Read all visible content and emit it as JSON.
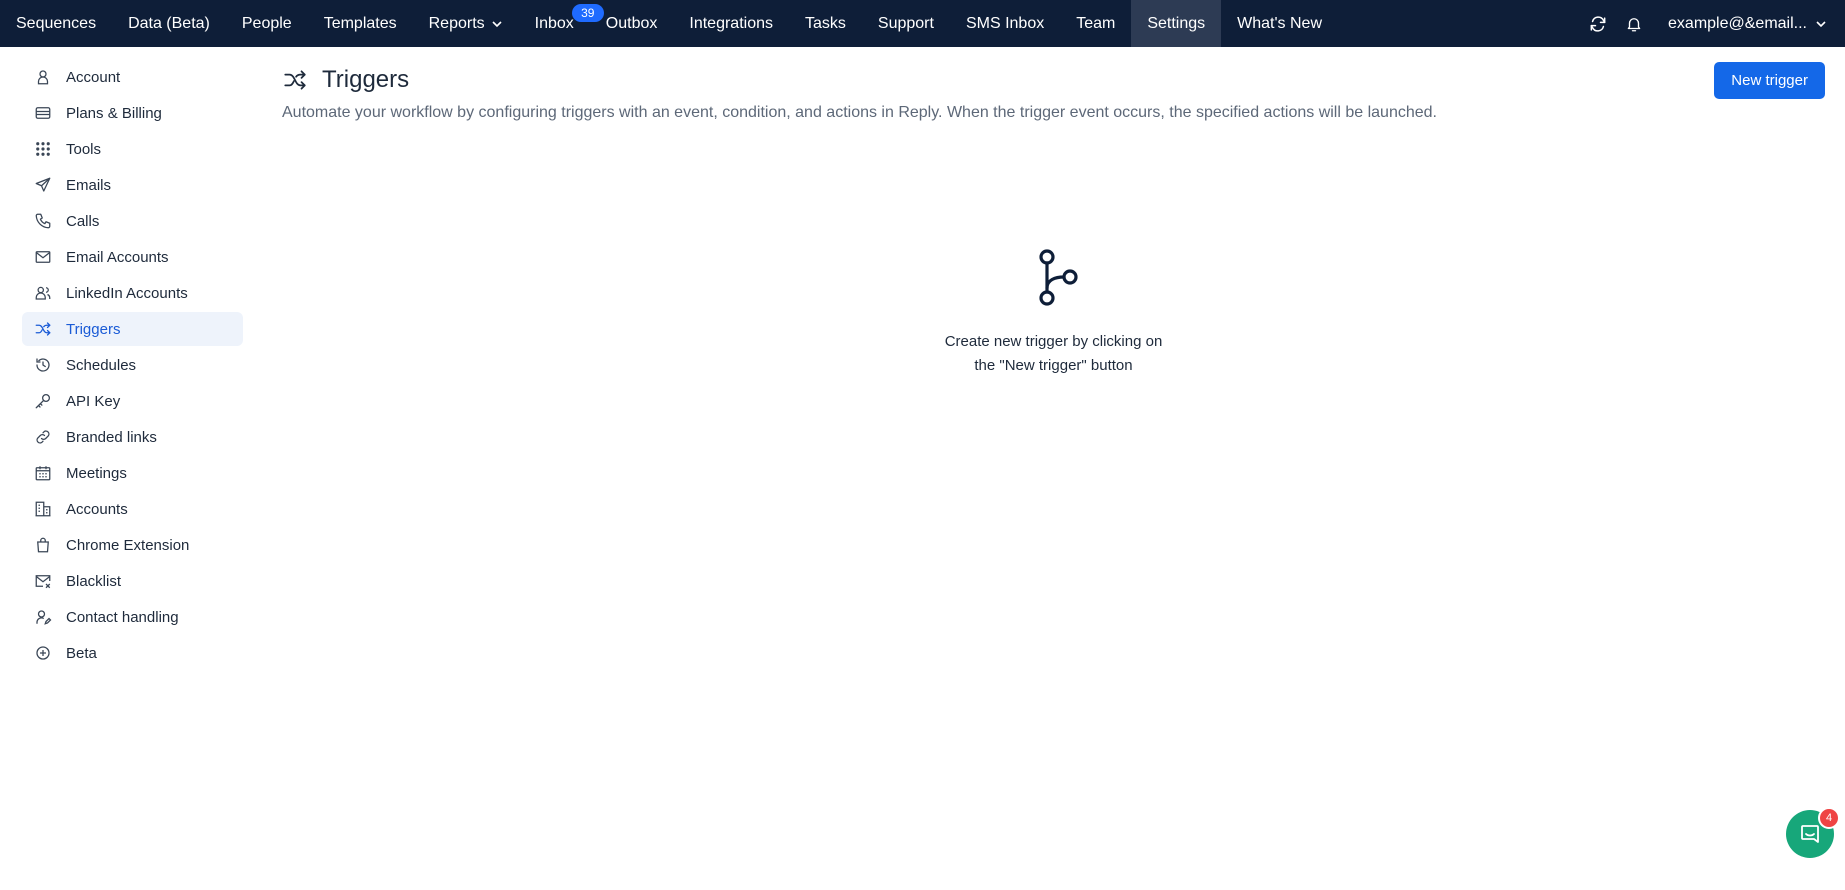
{
  "topnav": {
    "items": [
      {
        "label": "Sequences"
      },
      {
        "label": "Data (Beta)"
      },
      {
        "label": "People"
      },
      {
        "label": "Templates"
      },
      {
        "label": "Reports"
      },
      {
        "label": "Inbox",
        "badge": "39"
      },
      {
        "label": "Outbox"
      },
      {
        "label": "Integrations"
      },
      {
        "label": "Tasks"
      },
      {
        "label": "Support"
      },
      {
        "label": "SMS Inbox"
      },
      {
        "label": "Team"
      },
      {
        "label": "Settings"
      },
      {
        "label": "What's New"
      }
    ],
    "active": "Settings",
    "user": "example@&email..."
  },
  "sidebar": {
    "items": [
      {
        "label": "Account",
        "icon": "user-icon"
      },
      {
        "label": "Plans & Billing",
        "icon": "credit-card-icon"
      },
      {
        "label": "Tools",
        "icon": "grid-dots-icon"
      },
      {
        "label": "Emails",
        "icon": "send-icon"
      },
      {
        "label": "Calls",
        "icon": "phone-icon"
      },
      {
        "label": "Email Accounts",
        "icon": "mail-icon"
      },
      {
        "label": "LinkedIn Accounts",
        "icon": "users-icon"
      },
      {
        "label": "Triggers",
        "icon": "shuffle-icon"
      },
      {
        "label": "Schedules",
        "icon": "history-icon"
      },
      {
        "label": "API Key",
        "icon": "key-icon"
      },
      {
        "label": "Branded links",
        "icon": "link-icon"
      },
      {
        "label": "Meetings",
        "icon": "calendar-icon"
      },
      {
        "label": "Accounts",
        "icon": "building-icon"
      },
      {
        "label": "Chrome Extension",
        "icon": "shopping-bag-icon"
      },
      {
        "label": "Blacklist",
        "icon": "mail-block-icon"
      },
      {
        "label": "Contact handling",
        "icon": "user-edit-icon"
      },
      {
        "label": "Beta",
        "icon": "plus-circle-icon"
      }
    ],
    "active": "Triggers"
  },
  "main": {
    "title": "Triggers",
    "description": "Automate your workflow by configuring triggers with an event, condition, and actions in Reply. When the trigger event occurs, the specified actions will be launched.",
    "new_button": "New trigger",
    "empty_line1": "Create new trigger by clicking on",
    "empty_line2": "the \"New trigger\" button"
  },
  "chat": {
    "badge": "4"
  },
  "colors": {
    "nav_bg": "#0e1e38",
    "accent": "#1468e8",
    "active_sidebar_text": "#1a5bd6",
    "chat_bg": "#17a77a"
  }
}
